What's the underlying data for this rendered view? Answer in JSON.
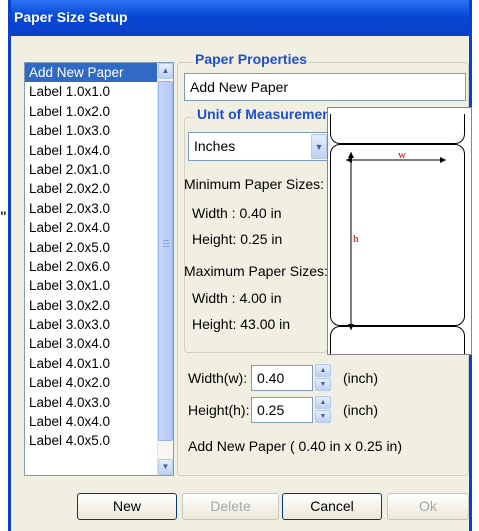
{
  "window": {
    "title": "Paper Size Setup"
  },
  "stray_mark": "\"",
  "paper_list": {
    "items": [
      "Add New Paper",
      "Label 1.0x1.0",
      "Label 1.0x2.0",
      "Label 1.0x3.0",
      "Label 1.0x4.0",
      "Label 2.0x1.0",
      "Label 2.0x2.0",
      "Label 2.0x3.0",
      "Label 2.0x4.0",
      "Label 2.0x5.0",
      "Label 2.0x6.0",
      "Label 3.0x1.0",
      "Label 3.0x2.0",
      "Label 3.0x3.0",
      "Label 3.0x4.0",
      "Label 4.0x1.0",
      "Label 4.0x2.0",
      "Label 4.0x3.0",
      "Label 4.0x4.0",
      "Label 4.0x5.0"
    ],
    "selected": "Add New Paper"
  },
  "paper_properties": {
    "title": "Paper Properties",
    "name_value": "Add New Paper"
  },
  "unit": {
    "title": "Unit of Measurement",
    "selected": "Inches"
  },
  "min_sizes": {
    "title": "Minimum Paper Sizes:",
    "width": "Width : 0.40 in",
    "height": "Height: 0.25 in"
  },
  "max_sizes": {
    "title": "Maximum Paper Sizes:",
    "width": "Width : 4.00 in",
    "height": "Height: 43.00 in"
  },
  "preview": {
    "w_label": "w",
    "h_label": "h",
    "accent": "#cc0000"
  },
  "dims": {
    "width_label": "Width(w):",
    "width_value": "0.40",
    "width_unit": "(inch)",
    "height_label": "Height(h):",
    "height_value": "0.25",
    "height_unit": "(inch)",
    "summary": "Add New Paper ( 0.40 in x 0.25 in)"
  },
  "buttons": {
    "new": "New",
    "delete": "Delete",
    "cancel": "Cancel",
    "ok": "Ok"
  },
  "icons": {
    "scroll_up": "▲",
    "scroll_down": "▼",
    "dropdown": "▼"
  },
  "colors": {
    "title_bar": "#0a3fd1",
    "selection": "#316ac5",
    "group_title": "#1f4fd1"
  }
}
